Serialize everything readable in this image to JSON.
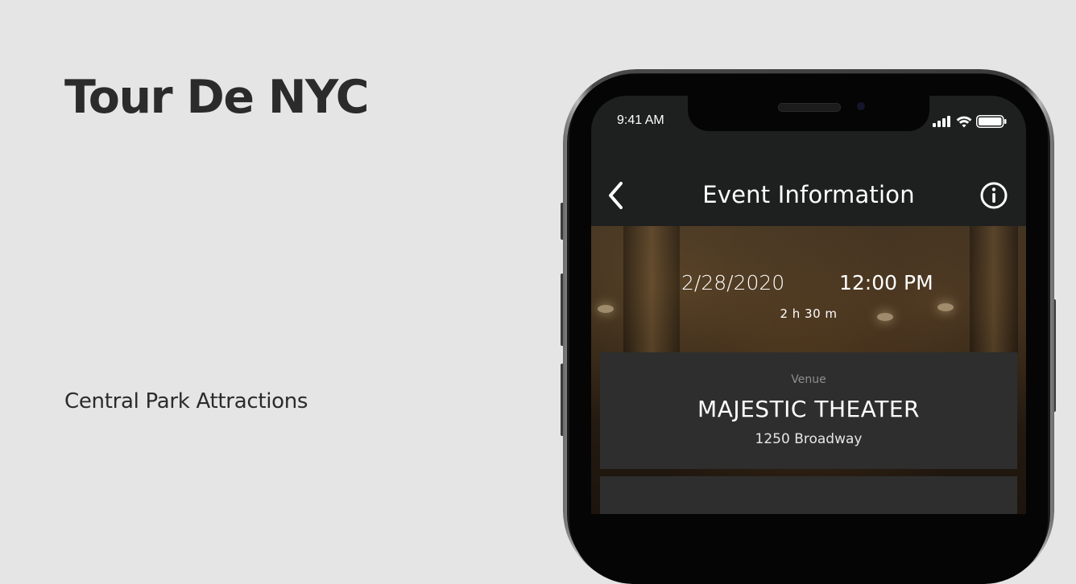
{
  "page": {
    "title": "Tour De NYC",
    "subtitle": "Central Park Attractions"
  },
  "status_bar": {
    "time": "9:41 AM",
    "icons": [
      "signal-icon",
      "wifi-icon",
      "battery-icon"
    ]
  },
  "app_header": {
    "title": "Event Information",
    "back_icon": "chevron-left-icon",
    "info_icon": "info-icon"
  },
  "event": {
    "date": "2/28/2020",
    "time": "12:00 PM",
    "duration": "2 h 30 m"
  },
  "venue": {
    "label": "Venue",
    "name": "MAJESTIC THEATER",
    "address": "1250 Broadway"
  },
  "colors": {
    "background": "#e5e5e5",
    "title_text": "#2b2b2b",
    "screen_bg": "#1e1f1f",
    "card_bg": "#2e2e2e",
    "muted_text": "#8e8e8e"
  }
}
